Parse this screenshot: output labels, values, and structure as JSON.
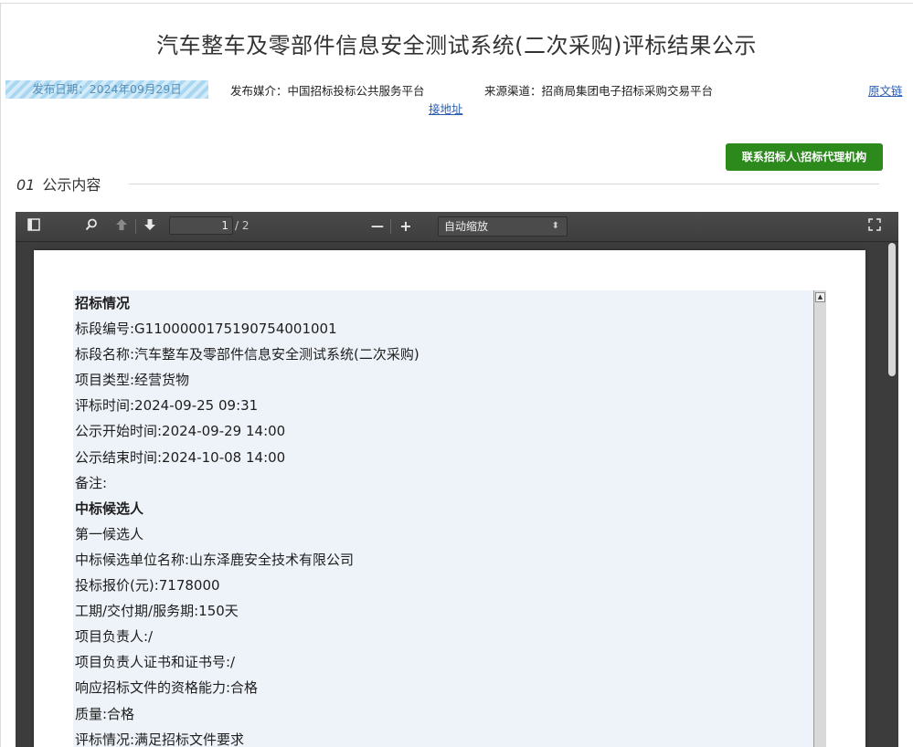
{
  "title": "汽车整车及零部件信息安全测试系统(二次采购)评标结果公示",
  "meta": {
    "publish_date": "发布日期：2024年09月29日",
    "media": "发布媒介：中国招标投标公共服务平台",
    "source": "来源渠道：招商局集团电子招标采购交易平台",
    "original_link_a": "原文链",
    "original_link_b": "接地址"
  },
  "contact_button": "联系招标人\\招标代理机构",
  "section": {
    "number": "01",
    "label": "公示内容"
  },
  "viewer": {
    "page_current": "1",
    "page_total": "/ 2",
    "zoom_option": "自动缩放",
    "zoom_out_label": "—",
    "zoom_in_label": "+"
  },
  "icons": {
    "sidebar": "sidebar-toggle-icon",
    "search": "search-icon",
    "prev": "arrow-up-icon",
    "next": "arrow-down-icon",
    "fullscreen": "fullscreen-icon"
  },
  "document_lines": [
    {
      "text": "招标情况",
      "bold": true
    },
    {
      "text": "标段编号:G1100000175190754001001",
      "bold": false
    },
    {
      "text": "标段名称:汽车整车及零部件信息安全测试系统(二次采购)",
      "bold": false
    },
    {
      "text": "项目类型:经营货物",
      "bold": false
    },
    {
      "text": "评标时间:2024-09-25 09:31",
      "bold": false
    },
    {
      "text": "公示开始时间:2024-09-29 14:00",
      "bold": false
    },
    {
      "text": "公示结束时间:2024-10-08 14:00",
      "bold": false
    },
    {
      "text": "备注:",
      "bold": false
    },
    {
      "text": "中标候选人",
      "bold": true
    },
    {
      "text": "第一候选人",
      "bold": false
    },
    {
      "text": "中标候选单位名称:山东泽鹿安全技术有限公司",
      "bold": false
    },
    {
      "text": "投标报价(元):7178000",
      "bold": false
    },
    {
      "text": "工期/交付期/服务期:150天",
      "bold": false
    },
    {
      "text": "项目负责人:/",
      "bold": false
    },
    {
      "text": "项目负责人证书和证书号:/",
      "bold": false
    },
    {
      "text": "响应招标文件的资格能力:合格",
      "bold": false
    },
    {
      "text": "质量:合格",
      "bold": false
    },
    {
      "text": "评标情况:满足招标文件要求",
      "bold": false
    }
  ],
  "colors": {
    "button_green": "#2c8a1c",
    "link_blue": "#2a5db0",
    "viewer_bg": "#3c3c3c"
  }
}
